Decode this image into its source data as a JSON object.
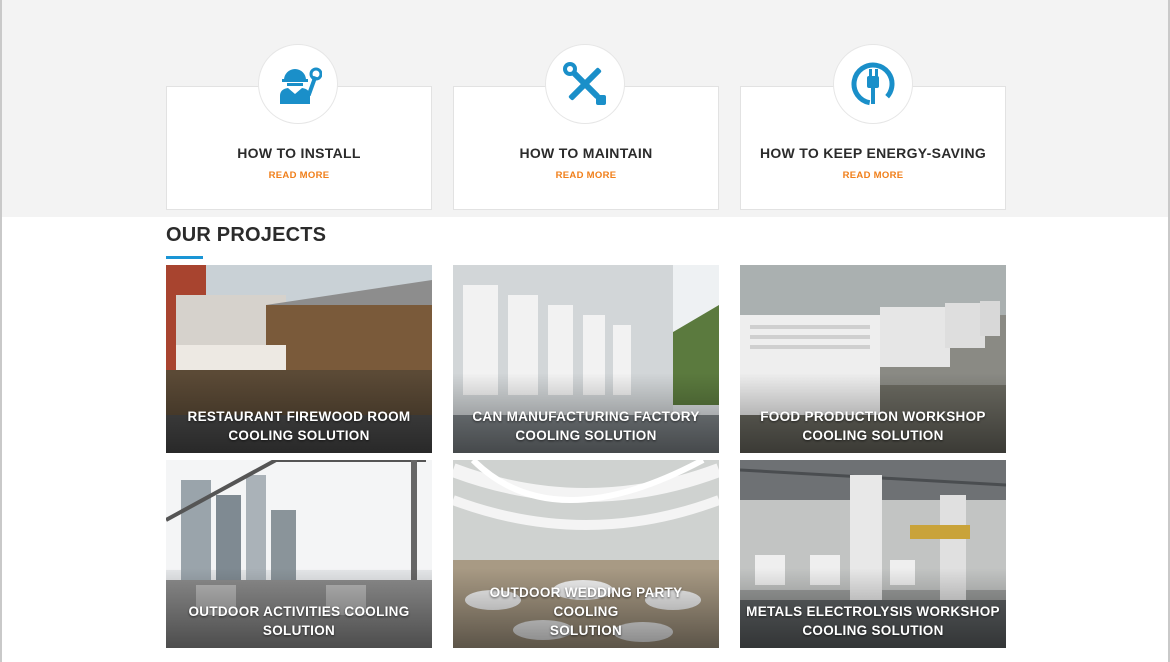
{
  "services": [
    {
      "icon": "engineer-wrench-icon",
      "title": "HOW TO INSTALL",
      "link": "READ MORE"
    },
    {
      "icon": "crossed-tools-icon",
      "title": "HOW TO MAINTAIN",
      "link": "READ MORE"
    },
    {
      "icon": "power-plug-icon",
      "title": "HOW TO KEEP ENERGY-SAVING",
      "link": "READ MORE"
    }
  ],
  "projects_section": {
    "title": "OUR PROJECTS",
    "items": [
      {
        "line1": "RESTAURANT FIREWOOD ROOM",
        "line2": "COOLING SOLUTION"
      },
      {
        "line1": "CAN MANUFACTURING FACTORY",
        "line2": "COOLING SOLUTION"
      },
      {
        "line1": "FOOD PRODUCTION WORKSHOP",
        "line2": "COOLING SOLUTION"
      },
      {
        "line1": "OUTDOOR ACTIVITIES COOLING",
        "line2": "SOLUTION"
      },
      {
        "line1": "OUTDOOR WEDDING PARTY COOLING",
        "line2": "SOLUTION"
      },
      {
        "line1": "METALS ELECTROLYSIS WORKSHOP",
        "line2": "COOLING SOLUTION"
      }
    ]
  },
  "colors": {
    "accent_blue": "#1a95d5",
    "link_orange": "#f07f1a",
    "band_gray": "#f3f3f3",
    "icon_blue": "#1a8fc9"
  }
}
